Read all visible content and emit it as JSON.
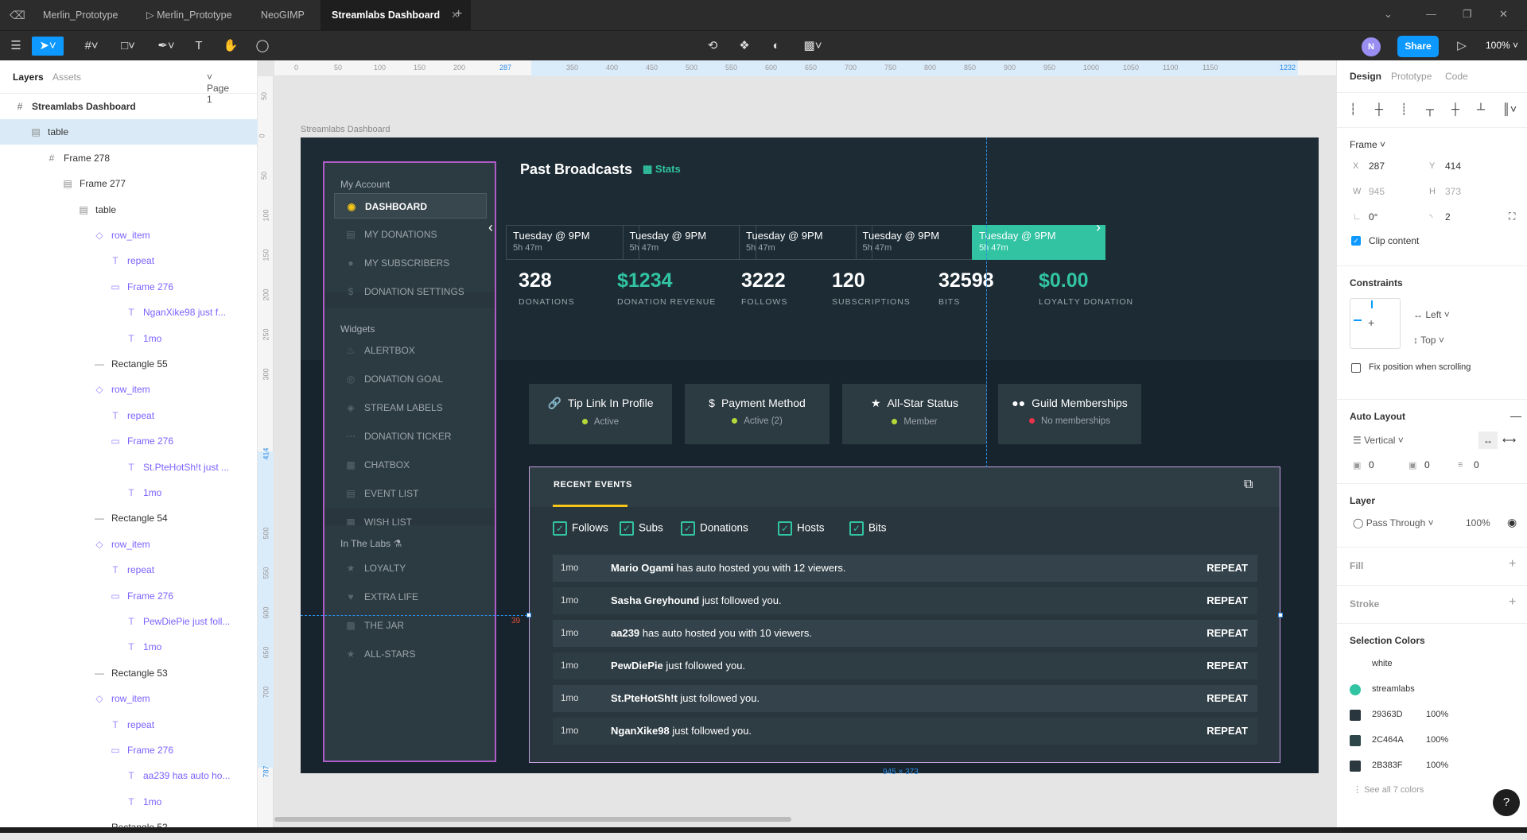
{
  "tabs": [
    "Merlin_Prototype",
    "Merlin_Prototype",
    "NeoGIMP",
    "Streamlabs Dashboard"
  ],
  "toolbar": {
    "avatar": "N",
    "share": "Share",
    "zoom": "100%"
  },
  "layers": {
    "tab_layers": "Layers",
    "tab_assets": "Assets",
    "page": "Page 1",
    "items": [
      "Streamlabs Dashboard",
      "table",
      "Frame 278",
      "Frame 277",
      "table",
      "row_item",
      "repeat",
      "Frame 276",
      "NganXike98 just f...",
      "1mo",
      "Rectangle 55",
      "row_item",
      "repeat",
      "Frame 276",
      "St.PteHotSh!t just ...",
      "1mo",
      "Rectangle 54",
      "row_item",
      "repeat",
      "Frame 276",
      "PewDiePie just foll...",
      "1mo",
      "Rectangle 53",
      "row_item",
      "repeat",
      "Frame 276",
      "aa239 has auto ho...",
      "1mo",
      "Rectangle 52"
    ]
  },
  "ruler": {
    "top": [
      "0",
      "50",
      "100",
      "150",
      "200",
      "287",
      "350",
      "400",
      "450",
      "500",
      "550",
      "600",
      "650",
      "700",
      "750",
      "800",
      "850",
      "900",
      "950",
      "1000",
      "1050",
      "1100",
      "1150",
      "1232"
    ],
    "left": [
      "50",
      "0",
      "50",
      "100",
      "150",
      "200",
      "250",
      "300",
      "414",
      "500",
      "550",
      "600",
      "650",
      "700",
      "787"
    ]
  },
  "frame_label": "Streamlabs Dashboard",
  "dash": {
    "sidebar": {
      "my_account": "My Account",
      "account_items": [
        "DASHBOARD",
        "MY DONATIONS",
        "MY SUBSCRIBERS",
        "DONATION SETTINGS"
      ],
      "widgets": "Widgets",
      "widget_items": [
        "ALERTBOX",
        "DONATION GOAL",
        "STREAM LABELS",
        "DONATION TICKER",
        "CHATBOX",
        "EVENT LIST",
        "WISH LIST"
      ],
      "labs": "In The Labs",
      "labs_items": [
        "LOYALTY",
        "EXTRA LIFE",
        "THE JAR",
        "ALL-STARS"
      ]
    },
    "title": "Past Broadcasts",
    "stats_link": "Stats",
    "broadcasts": [
      {
        "day": "Tuesday @ 9PM",
        "dur": "5h 47m"
      },
      {
        "day": "Tuesday @ 9PM",
        "dur": "5h 47m"
      },
      {
        "day": "Tuesday @ 9PM",
        "dur": "5h 47m"
      },
      {
        "day": "Tuesday @ 9PM",
        "dur": "5h 47m"
      },
      {
        "day": "Tuesday @ 9PM",
        "dur": "5h 47m"
      }
    ],
    "stats": [
      {
        "value": "328",
        "label": "DONATIONS"
      },
      {
        "value": "$1234",
        "label": "DONATION REVENUE"
      },
      {
        "value": "3222",
        "label": "FOLLOWS"
      },
      {
        "value": "120",
        "label": "SUBSCRIPTIONS"
      },
      {
        "value": "32598",
        "label": "BITS"
      },
      {
        "value": "$0.00",
        "label": "LOYALTY DONATION"
      }
    ],
    "cards": [
      {
        "title": "Tip Link In Profile",
        "status": "Active"
      },
      {
        "title": "Payment Method",
        "status": "Active (2)"
      },
      {
        "title": "All-Star Status",
        "status": "Member"
      },
      {
        "title": "Guild Memberships",
        "status": "No memberships"
      }
    ],
    "events": {
      "title": "RECENT EVENTS",
      "filters": [
        "Follows",
        "Subs",
        "Donations",
        "Hosts",
        "Bits"
      ],
      "rows": [
        {
          "time": "1mo",
          "name": "Mario Ogami",
          "text": " has auto hosted you with 12 viewers.",
          "action": "REPEAT"
        },
        {
          "time": "1mo",
          "name": "Sasha Greyhound",
          "text": " just followed you.",
          "action": "REPEAT"
        },
        {
          "time": "1mo",
          "name": "aa239",
          "text": " has auto hosted you with 10 viewers.",
          "action": "REPEAT"
        },
        {
          "time": "1mo",
          "name": "PewDiePie",
          "text": " just followed you.",
          "action": "REPEAT"
        },
        {
          "time": "1mo",
          "name": "St.PteHotSh!t",
          "text": " just followed you.",
          "action": "REPEAT"
        },
        {
          "time": "1mo",
          "name": "NganXike98",
          "text": " just followed you.",
          "action": "REPEAT"
        }
      ]
    }
  },
  "measure": {
    "gap": "39",
    "dims": "945 × 373"
  },
  "props": {
    "tabs": [
      "Design",
      "Prototype",
      "Code"
    ],
    "frame": "Frame",
    "x_label": "X",
    "x": "287",
    "y_label": "Y",
    "y": "414",
    "w_label": "W",
    "w": "945",
    "h_label": "H",
    "h": "373",
    "rotation": "0°",
    "radius": "2",
    "clip": "Clip content",
    "constraints": "Constraints",
    "h_con": "Left",
    "v_con": "Top",
    "fix": "Fix position when scrolling",
    "auto_layout": "Auto Layout",
    "direction": "Vertical",
    "pad1": "0",
    "pad2": "0",
    "pad3": "0",
    "layer": "Layer",
    "blend": "Pass Through",
    "opacity": "100%",
    "fill": "Fill",
    "stroke": "Stroke",
    "selection_colors": "Selection Colors",
    "colors": [
      {
        "name": "white",
        "hex": "#ffffff",
        "pct": ""
      },
      {
        "name": "streamlabs",
        "hex": "#31c3a2",
        "pct": ""
      },
      {
        "name": "29363D",
        "hex": "#29363d",
        "pct": "100%"
      },
      {
        "name": "2C464A",
        "hex": "#2c464a",
        "pct": "100%"
      },
      {
        "name": "2B383F",
        "hex": "#2b383f",
        "pct": "100%"
      }
    ],
    "see_all": "See all 7 colors"
  },
  "colors": {
    "accent": "#0d99ff",
    "streamlabs": "#31c3a2",
    "selection": "#b05cc8"
  }
}
